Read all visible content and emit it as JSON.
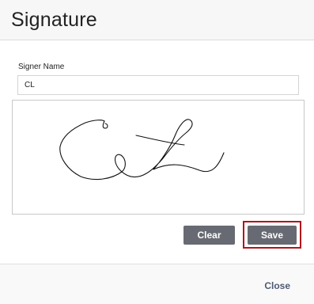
{
  "dialog": {
    "title": "Signature"
  },
  "signer": {
    "label": "Signer Name",
    "value": "CL"
  },
  "signature_pad": {
    "ink_color": "#111111",
    "strokes": [
      "M 116 26 C 113 24, 104 24, 92 28 C 76 35, 63 45, 60 58 C 58 72, 70 88, 86 96 C 104 103, 126 99, 138 90 C 144 85, 144 74, 137 69 C 127 64, 125 84, 144 94 C 162 103, 179 86, 190 73 C 200 60, 210 48, 219 41 C 225 36, 230 30, 225 25 C 219 20, 210 32, 205 45 C 199 60, 186 78, 178 87 C 198 78, 215 80, 236 88 C 252 94, 260 83, 267 66",
      "M 156 44 C 174 48, 199 54, 217 56",
      "M 116 26 C 114 30, 113 35, 117 35 C 121 35, 121 30, 117 29"
    ]
  },
  "actions": {
    "clear_label": "Clear",
    "save_label": "Save",
    "save_highlight_color": "#b3141b",
    "button_color": "#686a73"
  },
  "footer": {
    "close_label": "Close"
  }
}
